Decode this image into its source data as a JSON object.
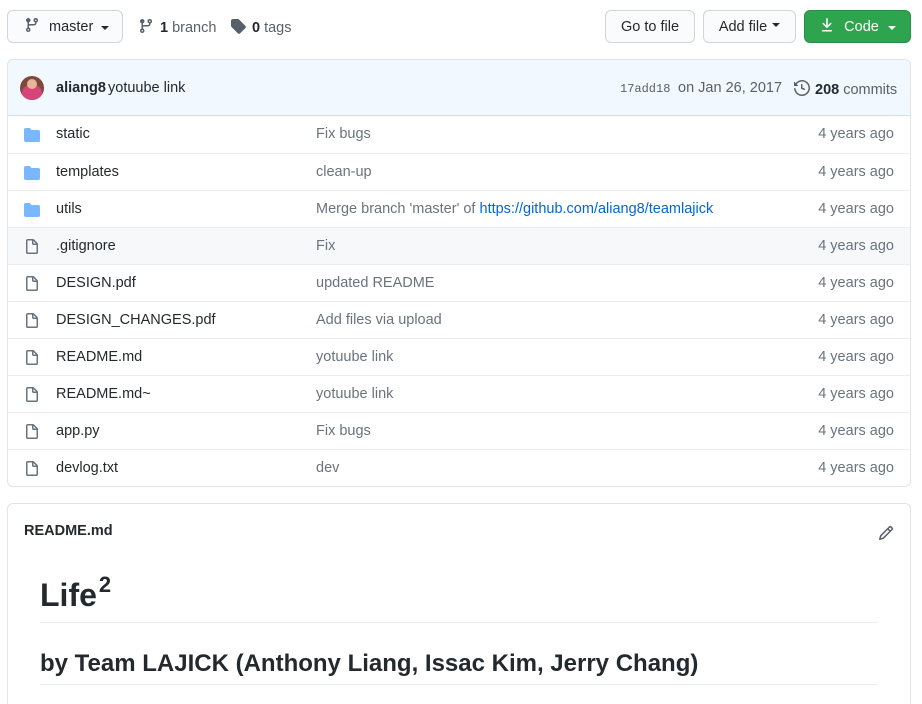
{
  "topbar": {
    "branch_name": "master",
    "branches_count": "1",
    "branches_label": "branch",
    "tags_count": "0",
    "tags_label": "tags",
    "go_to_file": "Go to file",
    "add_file": "Add file",
    "code": "Code"
  },
  "commit": {
    "author": "aliang8",
    "message": "yotuube link",
    "sha": "17add18",
    "date": "on Jan 26, 2017",
    "count": "208",
    "count_label": "commits"
  },
  "files": [
    {
      "name": "static",
      "type": "folder",
      "message": "Fix bugs",
      "age": "4 years ago"
    },
    {
      "name": "templates",
      "type": "folder",
      "message": "clean-up",
      "age": "4 years ago"
    },
    {
      "name": "utils",
      "type": "folder",
      "message": "Merge branch 'master' of ",
      "link": "https://github.com/aliang8/teamlajick",
      "age": "4 years ago"
    },
    {
      "name": ".gitignore",
      "type": "file",
      "message": "Fix",
      "age": "4 years ago"
    },
    {
      "name": "DESIGN.pdf",
      "type": "file",
      "message": "updated README",
      "age": "4 years ago"
    },
    {
      "name": "DESIGN_CHANGES.pdf",
      "type": "file",
      "message": "Add files via upload",
      "age": "4 years ago"
    },
    {
      "name": "README.md",
      "type": "file",
      "message": "yotuube link",
      "age": "4 years ago"
    },
    {
      "name": "README.md~",
      "type": "file",
      "message": "yotuube link",
      "age": "4 years ago"
    },
    {
      "name": "app.py",
      "type": "file",
      "message": "Fix bugs",
      "age": "4 years ago"
    },
    {
      "name": "devlog.txt",
      "type": "file",
      "message": "dev",
      "age": "4 years ago"
    }
  ],
  "readme": {
    "filename": "README.md",
    "heading": "Life",
    "heading_sup": "2",
    "subheading": "by Team LAJICK (Anthony Liang, Issac Kim, Jerry Chang)"
  },
  "colors": {
    "accent_green": "#2ea44f",
    "link_blue": "#0366d6",
    "folder_blue": "#79b8ff",
    "commit_bar_bg": "#f1f8ff"
  },
  "icons": {
    "branch": "git-branch-icon",
    "tag": "tag-icon",
    "download": "download-icon",
    "history": "history-icon",
    "folder": "folder-icon",
    "file": "file-icon",
    "edit": "pencil-icon"
  }
}
